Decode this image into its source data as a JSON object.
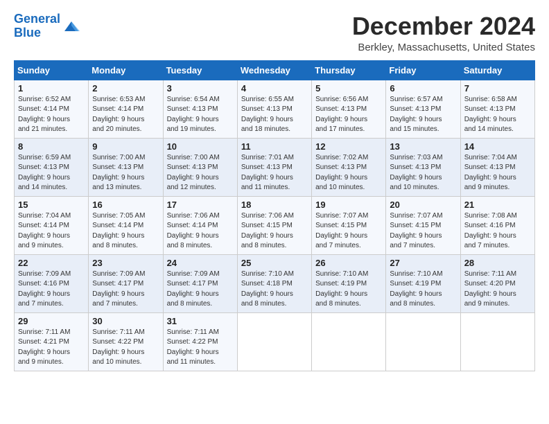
{
  "logo": {
    "line1": "General",
    "line2": "Blue"
  },
  "title": "December 2024",
  "location": "Berkley, Massachusetts, United States",
  "days_of_week": [
    "Sunday",
    "Monday",
    "Tuesday",
    "Wednesday",
    "Thursday",
    "Friday",
    "Saturday"
  ],
  "weeks": [
    [
      {
        "day": "1",
        "lines": [
          "Sunrise: 6:52 AM",
          "Sunset: 4:14 PM",
          "Daylight: 9 hours",
          "and 21 minutes."
        ]
      },
      {
        "day": "2",
        "lines": [
          "Sunrise: 6:53 AM",
          "Sunset: 4:14 PM",
          "Daylight: 9 hours",
          "and 20 minutes."
        ]
      },
      {
        "day": "3",
        "lines": [
          "Sunrise: 6:54 AM",
          "Sunset: 4:13 PM",
          "Daylight: 9 hours",
          "and 19 minutes."
        ]
      },
      {
        "day": "4",
        "lines": [
          "Sunrise: 6:55 AM",
          "Sunset: 4:13 PM",
          "Daylight: 9 hours",
          "and 18 minutes."
        ]
      },
      {
        "day": "5",
        "lines": [
          "Sunrise: 6:56 AM",
          "Sunset: 4:13 PM",
          "Daylight: 9 hours",
          "and 17 minutes."
        ]
      },
      {
        "day": "6",
        "lines": [
          "Sunrise: 6:57 AM",
          "Sunset: 4:13 PM",
          "Daylight: 9 hours",
          "and 15 minutes."
        ]
      },
      {
        "day": "7",
        "lines": [
          "Sunrise: 6:58 AM",
          "Sunset: 4:13 PM",
          "Daylight: 9 hours",
          "and 14 minutes."
        ]
      }
    ],
    [
      {
        "day": "8",
        "lines": [
          "Sunrise: 6:59 AM",
          "Sunset: 4:13 PM",
          "Daylight: 9 hours",
          "and 14 minutes."
        ]
      },
      {
        "day": "9",
        "lines": [
          "Sunrise: 7:00 AM",
          "Sunset: 4:13 PM",
          "Daylight: 9 hours",
          "and 13 minutes."
        ]
      },
      {
        "day": "10",
        "lines": [
          "Sunrise: 7:00 AM",
          "Sunset: 4:13 PM",
          "Daylight: 9 hours",
          "and 12 minutes."
        ]
      },
      {
        "day": "11",
        "lines": [
          "Sunrise: 7:01 AM",
          "Sunset: 4:13 PM",
          "Daylight: 9 hours",
          "and 11 minutes."
        ]
      },
      {
        "day": "12",
        "lines": [
          "Sunrise: 7:02 AM",
          "Sunset: 4:13 PM",
          "Daylight: 9 hours",
          "and 10 minutes."
        ]
      },
      {
        "day": "13",
        "lines": [
          "Sunrise: 7:03 AM",
          "Sunset: 4:13 PM",
          "Daylight: 9 hours",
          "and 10 minutes."
        ]
      },
      {
        "day": "14",
        "lines": [
          "Sunrise: 7:04 AM",
          "Sunset: 4:13 PM",
          "Daylight: 9 hours",
          "and 9 minutes."
        ]
      }
    ],
    [
      {
        "day": "15",
        "lines": [
          "Sunrise: 7:04 AM",
          "Sunset: 4:14 PM",
          "Daylight: 9 hours",
          "and 9 minutes."
        ]
      },
      {
        "day": "16",
        "lines": [
          "Sunrise: 7:05 AM",
          "Sunset: 4:14 PM",
          "Daylight: 9 hours",
          "and 8 minutes."
        ]
      },
      {
        "day": "17",
        "lines": [
          "Sunrise: 7:06 AM",
          "Sunset: 4:14 PM",
          "Daylight: 9 hours",
          "and 8 minutes."
        ]
      },
      {
        "day": "18",
        "lines": [
          "Sunrise: 7:06 AM",
          "Sunset: 4:15 PM",
          "Daylight: 9 hours",
          "and 8 minutes."
        ]
      },
      {
        "day": "19",
        "lines": [
          "Sunrise: 7:07 AM",
          "Sunset: 4:15 PM",
          "Daylight: 9 hours",
          "and 7 minutes."
        ]
      },
      {
        "day": "20",
        "lines": [
          "Sunrise: 7:07 AM",
          "Sunset: 4:15 PM",
          "Daylight: 9 hours",
          "and 7 minutes."
        ]
      },
      {
        "day": "21",
        "lines": [
          "Sunrise: 7:08 AM",
          "Sunset: 4:16 PM",
          "Daylight: 9 hours",
          "and 7 minutes."
        ]
      }
    ],
    [
      {
        "day": "22",
        "lines": [
          "Sunrise: 7:09 AM",
          "Sunset: 4:16 PM",
          "Daylight: 9 hours",
          "and 7 minutes."
        ]
      },
      {
        "day": "23",
        "lines": [
          "Sunrise: 7:09 AM",
          "Sunset: 4:17 PM",
          "Daylight: 9 hours",
          "and 7 minutes."
        ]
      },
      {
        "day": "24",
        "lines": [
          "Sunrise: 7:09 AM",
          "Sunset: 4:17 PM",
          "Daylight: 9 hours",
          "and 8 minutes."
        ]
      },
      {
        "day": "25",
        "lines": [
          "Sunrise: 7:10 AM",
          "Sunset: 4:18 PM",
          "Daylight: 9 hours",
          "and 8 minutes."
        ]
      },
      {
        "day": "26",
        "lines": [
          "Sunrise: 7:10 AM",
          "Sunset: 4:19 PM",
          "Daylight: 9 hours",
          "and 8 minutes."
        ]
      },
      {
        "day": "27",
        "lines": [
          "Sunrise: 7:10 AM",
          "Sunset: 4:19 PM",
          "Daylight: 9 hours",
          "and 8 minutes."
        ]
      },
      {
        "day": "28",
        "lines": [
          "Sunrise: 7:11 AM",
          "Sunset: 4:20 PM",
          "Daylight: 9 hours",
          "and 9 minutes."
        ]
      }
    ],
    [
      {
        "day": "29",
        "lines": [
          "Sunrise: 7:11 AM",
          "Sunset: 4:21 PM",
          "Daylight: 9 hours",
          "and 9 minutes."
        ]
      },
      {
        "day": "30",
        "lines": [
          "Sunrise: 7:11 AM",
          "Sunset: 4:22 PM",
          "Daylight: 9 hours",
          "and 10 minutes."
        ]
      },
      {
        "day": "31",
        "lines": [
          "Sunrise: 7:11 AM",
          "Sunset: 4:22 PM",
          "Daylight: 9 hours",
          "and 11 minutes."
        ]
      },
      null,
      null,
      null,
      null
    ]
  ]
}
